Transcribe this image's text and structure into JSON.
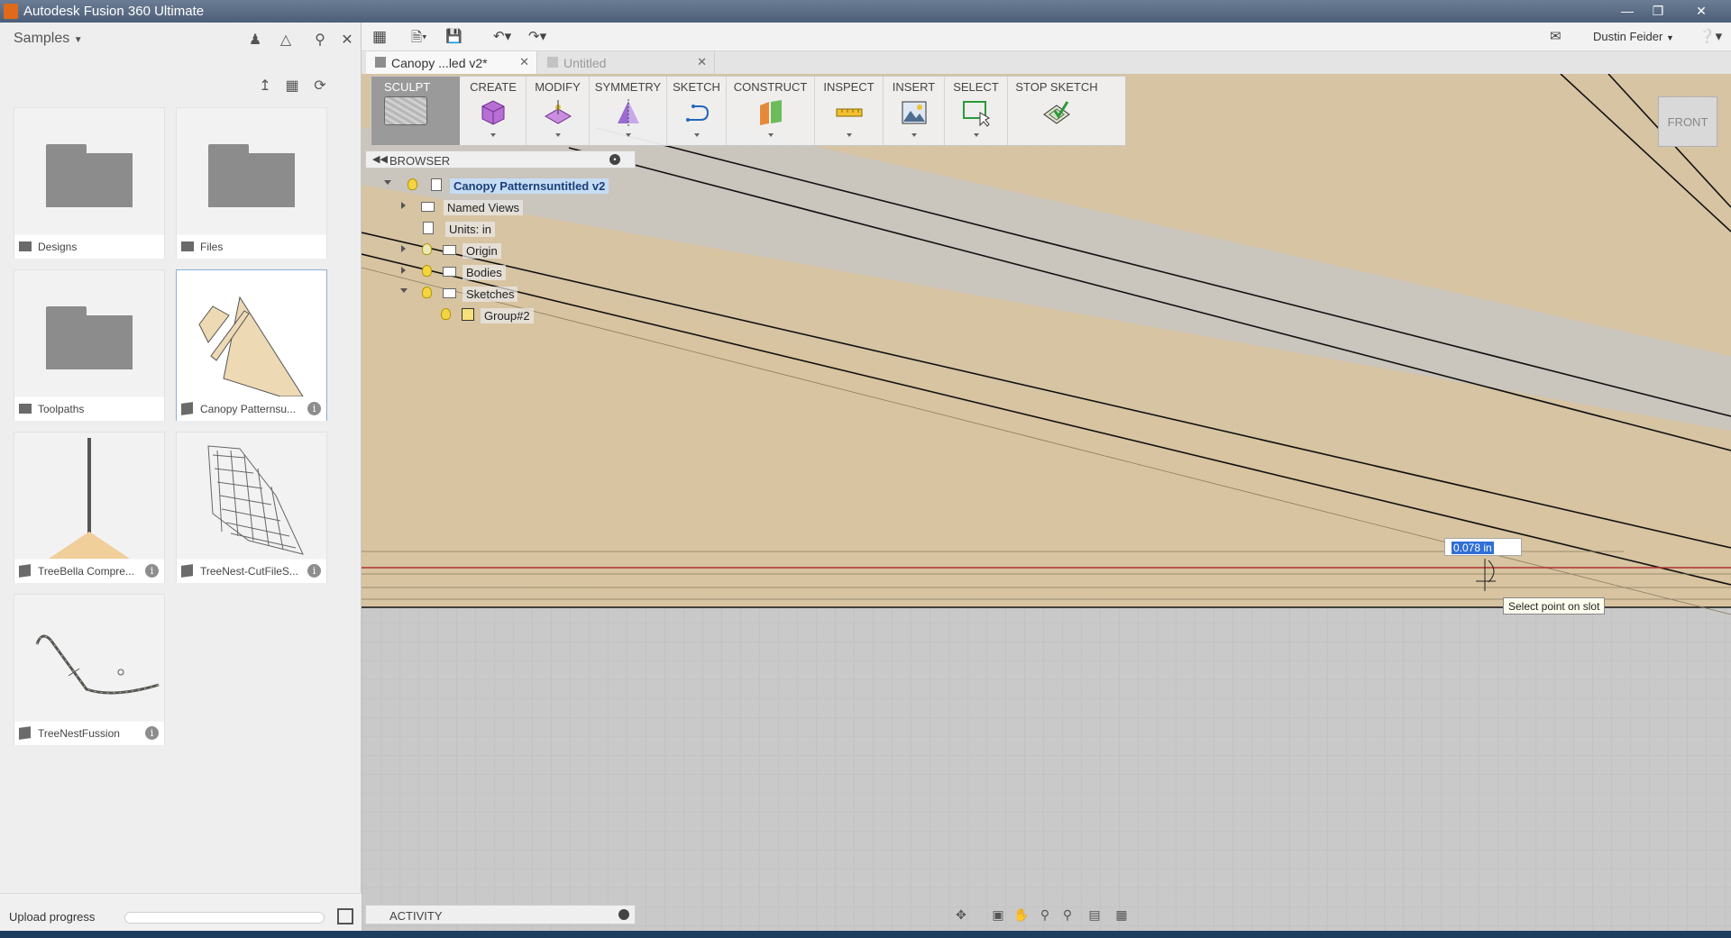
{
  "window": {
    "title": "Autodesk Fusion 360 Ultimate"
  },
  "data_panel": {
    "project": "Samples",
    "items": [
      {
        "label": "Designs",
        "kind": "folder"
      },
      {
        "label": "Files",
        "kind": "folder"
      },
      {
        "label": "Toolpaths",
        "kind": "folder"
      },
      {
        "label": "Canopy Patternsu...",
        "kind": "design"
      },
      {
        "label": "TreeBella Compre...",
        "kind": "design"
      },
      {
        "label": "TreeNest-CutFileS...",
        "kind": "design"
      },
      {
        "label": "TreeNestFussion",
        "kind": "design"
      }
    ],
    "upload_label": "Upload progress",
    "upload_progress": 0
  },
  "header": {
    "user": "Dustin Feider"
  },
  "doc_tabs": [
    {
      "label": "Canopy ...led v2*",
      "active": true
    },
    {
      "label": "Untitled",
      "active": false
    }
  ],
  "ribbon": {
    "workspace": "SCULPT",
    "groups": [
      {
        "label": "CREATE",
        "icon": "box-icon"
      },
      {
        "label": "MODIFY",
        "icon": "modify-icon"
      },
      {
        "label": "SYMMETRY",
        "icon": "symmetry-icon"
      },
      {
        "label": "SKETCH",
        "icon": "sketch-icon"
      },
      {
        "label": "CONSTRUCT",
        "icon": "construct-icon"
      },
      {
        "label": "INSPECT",
        "icon": "measure-icon"
      },
      {
        "label": "INSERT",
        "icon": "image-icon"
      },
      {
        "label": "SELECT",
        "icon": "select-icon"
      },
      {
        "label": "STOP SKETCH",
        "icon": "stop-sketch-icon"
      }
    ]
  },
  "browser": {
    "title": "BROWSER",
    "root": "Canopy Patternsuntitled v2",
    "nodes": [
      {
        "label": "Named Views"
      },
      {
        "label": "Units: in"
      },
      {
        "label": "Origin"
      },
      {
        "label": "Bodies"
      },
      {
        "label": "Sketches"
      },
      {
        "label": "Group#2"
      }
    ]
  },
  "dimension_input": "0.078 in",
  "tooltip": "Select point on slot",
  "viewcube": "FRONT",
  "activity": "ACTIVITY",
  "colors": {
    "surface": "#d7c4a0",
    "accent": "#2f6fd6",
    "origin_axis": "#b03030"
  }
}
